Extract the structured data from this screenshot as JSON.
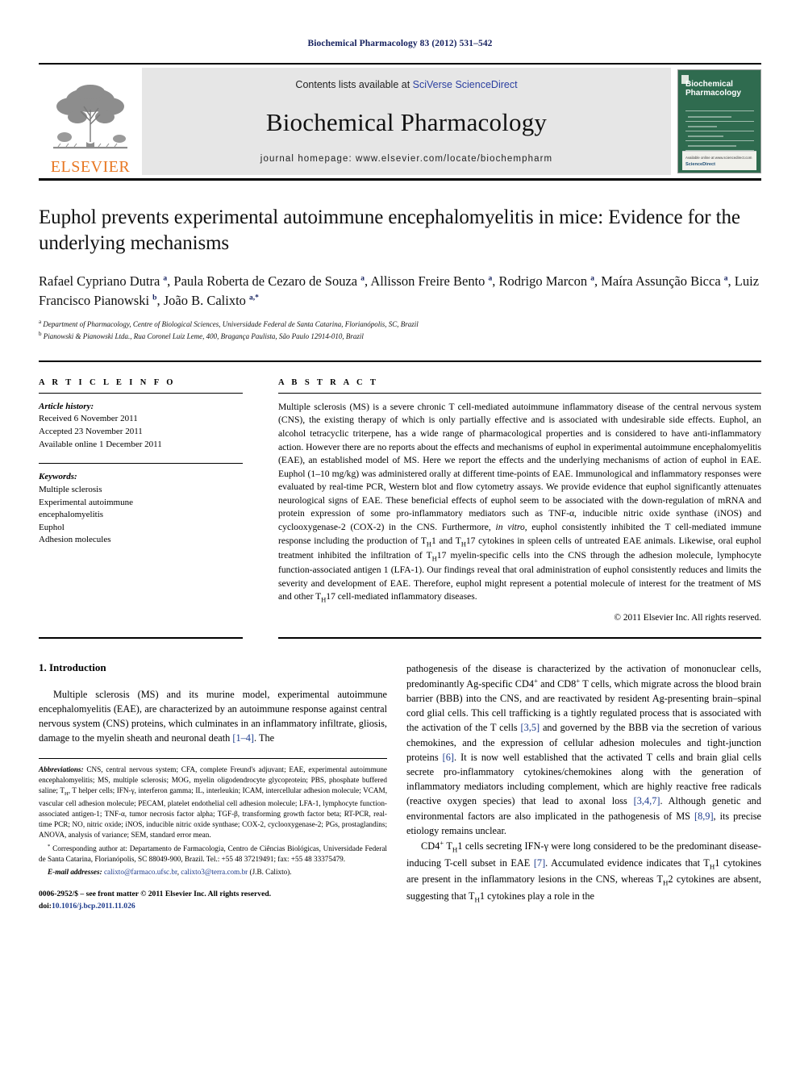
{
  "running_head": "Biochemical Pharmacology 83 (2012) 531–542",
  "masthead": {
    "publisher_name": "ELSEVIER",
    "contents_prefix": "Contents lists available at ",
    "contents_link": "SciVerse ScienceDirect",
    "journal_name": "Biochemical Pharmacology",
    "homepage_line": "journal homepage: www.elsevier.com/locate/biochempharm",
    "cover_title_line1": "Biochemical",
    "cover_title_line2": "Pharmacology",
    "cover_footer": "Available online at www.sciencedirect.com",
    "cover_brand": "ScienceDirect",
    "accent_orange": "#E87722",
    "link_blue": "#2b3fa0",
    "cover_green": "#2f6b4f"
  },
  "article": {
    "title": "Euphol prevents experimental autoimmune encephalomyelitis in mice: Evidence for the underlying mechanisms",
    "authors_html": "Rafael Cypriano Dutra <sup>a</sup>, Paula Roberta de Cezaro de Souza <sup>a</sup>, Allisson Freire Bento <sup>a</sup>, Rodrigo Marcon <sup>a</sup>, Maíra Assunção Bicca <sup>a</sup>, Luiz Francisco Pianowski <sup>b</sup>, João B. Calixto <sup>a,*</sup>",
    "affiliations": [
      "Department of Pharmacology, Centre of Biological Sciences, Universidade Federal de Santa Catarina, Florianópolis, SC, Brazil",
      "Pianowski & Pianowski Ltda., Rua Coronel Luiz Leme, 400, Bragança Paulista, São Paulo 12914-010, Brazil"
    ]
  },
  "article_info": {
    "heading": "A R T I C L E  I N F O",
    "history_label": "Article history:",
    "history": [
      "Received 6 November 2011",
      "Accepted 23 November 2011",
      "Available online 1 December 2011"
    ],
    "keywords_label": "Keywords:",
    "keywords": [
      "Multiple sclerosis",
      "Experimental autoimmune",
      "encephalomyelitis",
      "Euphol",
      "Adhesion molecules"
    ]
  },
  "abstract": {
    "heading": "A B S T R A C T",
    "body_html": "Multiple sclerosis (MS) is a severe chronic T cell-mediated autoimmune inflammatory disease of the central nervous system (CNS), the existing therapy of which is only partially effective and is associated with undesirable side effects. Euphol, an alcohol tetracyclic triterpene, has a wide range of pharmacological properties and is considered to have anti-inflammatory action. However there are no reports about the effects and mechanisms of euphol in experimental autoimmune encephalomyelitis (EAE), an established model of MS. Here we report the effects and the underlying mechanisms of action of euphol in EAE. Euphol (1–10 mg/kg) was administered orally at different time-points of EAE. Immunological and inflammatory responses were evaluated by real-time PCR, Western blot and flow cytometry assays. We provide evidence that euphol significantly attenuates neurological signs of EAE. These beneficial effects of euphol seem to be associated with the down-regulation of mRNA and protein expression of some pro-inflammatory mediators such as TNF-α, inducible nitric oxide synthase (iNOS) and cyclooxygenase-2 (COX-2) in the CNS. Furthermore, <i>in vitro</i>, euphol consistently inhibited the T cell-mediated immune response including the production of T<sub>H</sub>1 and T<sub>H</sub>17 cytokines in spleen cells of untreated EAE animals. Likewise, oral euphol treatment inhibited the infiltration of T<sub>H</sub>17 myelin-specific cells into the CNS through the adhesion molecule, lymphocyte function-associated antigen 1 (LFA-1). Our findings reveal that oral administration of euphol consistently reduces and limits the severity and development of EAE. Therefore, euphol might represent a potential molecule of interest for the treatment of MS and other T<sub>H</sub>17 cell-mediated inflammatory diseases.",
    "copyright": "© 2011 Elsevier Inc. All rights reserved."
  },
  "introduction": {
    "heading": "1. Introduction",
    "left_para_html": "Multiple sclerosis (MS) and its murine model, experimental autoimmune encephalomyelitis (EAE), are characterized by an autoimmune response against central nervous system (CNS) proteins, which culminates in an inflammatory infiltrate, gliosis, damage to the myelin sheath and neuronal death <span class=\"ref\">[1–4]</span>. The",
    "right_para1_html": "pathogenesis of the disease is characterized by the activation of mononuclear cells, predominantly Ag-specific CD4<sup class=\"inl\">+</sup> and CD8<sup class=\"inl\">+</sup> T cells, which migrate across the blood brain barrier (BBB) into the CNS, and are reactivated by resident Ag-presenting brain–spinal cord glial cells. This cell trafficking is a tightly regulated process that is associated with the activation of the T cells <span class=\"ref\">[3,5]</span> and governed by the BBB via the secretion of various chemokines, and the expression of cellular adhesion molecules and tight-junction proteins <span class=\"ref\">[6]</span>. It is now well established that the activated T cells and brain glial cells secrete pro-inflammatory cytokines/chemokines along with the generation of inflammatory mediators including complement, which are highly reactive free radicals (reactive oxygen species) that lead to axonal loss <span class=\"ref\">[3,4,7]</span>. Although genetic and environmental factors are also implicated in the pathogenesis of MS <span class=\"ref\">[8,9]</span>, its precise etiology remains unclear.",
    "right_para2_html": "CD4<sup class=\"inl\">+</sup> T<sub>H</sub>1 cells secreting IFN-γ were long considered to be the predominant disease-inducing T-cell subset in EAE <span class=\"ref\">[7]</span>. Accumulated evidence indicates that T<sub>H</sub>1 cytokines are present in the inflammatory lesions in the CNS, whereas T<sub>H</sub>2 cytokines are absent, suggesting that T<sub>H</sub>1 cytokines play a role in the"
  },
  "footnotes": {
    "abbreviations_html": "<span class=\"ital\">Abbreviations:</span> CNS, central nervous system; CFA, complete Freund's adjuvant; EAE, experimental autoimmune encephalomyelitis; MS, multiple sclerosis; MOG, myelin oligodendrocyte glycoprotein; PBS, phosphate buffered saline; T<sub>H</sub>, T helper cells; IFN-γ, interferon gamma; IL, interleukin; ICAM, intercellular adhesion molecule; VCAM, vascular cell adhesion molecule; PECAM, platelet endothelial cell adhesion molecule; LFA-1, lymphocyte function-associated antigen-1; TNF-α, tumor necrosis factor alpha; TGF-β, transforming growth factor beta; RT-PCR, real-time PCR; NO, nitric oxide; iNOS, inducible nitric oxide synthase; COX-2, cyclooxygenase-2; PGs, prostaglandins; ANOVA, analysis of variance; SEM, standard error mean.",
    "corresponding_html": "<sup class=\"inl\">*</sup> Corresponding author at: Departamento de Farmacologia, Centro de Ciências Biológicas, Universidade Federal de Santa Catarina, Florianópolis, SC 88049-900, Brazil. Tel.: +55 48 37219491; fax: +55 48 33375479.",
    "email_html": "<span class=\"ital\">E-mail addresses:</span> <span class=\"lnk\">calixto@farmaco.ufsc.br</span>, <span class=\"lnk\">calixto3@terra.com.br</span> (J.B. Calixto).",
    "imprint_line1_html": "0006-2952/$ – see front matter © 2011 Elsevier Inc. All rights reserved.",
    "imprint_line2_html": "doi:<span class=\"lnk\">10.1016/j.bcp.2011.11.026</span>"
  }
}
